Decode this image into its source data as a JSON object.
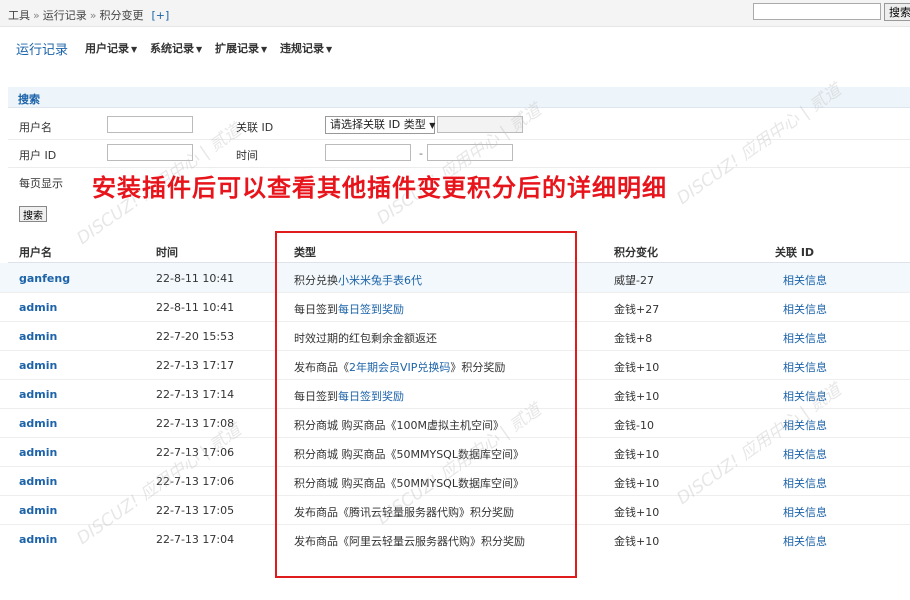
{
  "breadcrumb": {
    "items": [
      "工具",
      "运行记录",
      "积分变更"
    ],
    "separator": "»",
    "add": "[+]"
  },
  "top_search": {
    "value": "",
    "button": "搜索"
  },
  "nav": {
    "active": "运行记录",
    "menus": [
      "用户记录",
      "系统记录",
      "扩展记录",
      "违规记录"
    ],
    "caret": "▼"
  },
  "search_section": {
    "title": "搜索"
  },
  "filters": {
    "username_label": "用户名",
    "relation_label": "关联 ID",
    "relation_select": "请选择关联 ID 类型",
    "userid_label": "用户 ID",
    "time_label": "时间",
    "time_sep": "-",
    "perpage_label": "每页显示",
    "submit": "搜索"
  },
  "overlay_caption": "安装插件后可以查看其他插件变更积分后的详细明细",
  "table": {
    "headers": [
      "用户名",
      "时间",
      "类型",
      "积分变化",
      "关联 ID"
    ],
    "rows": [
      {
        "user": "ganfeng",
        "time": "22-8-11 10:41",
        "type_prefix": "积分兑换",
        "type_link": "小米米兔手表6代",
        "type_suffix": "",
        "change": "威望-27",
        "link": "相关信息"
      },
      {
        "user": "admin",
        "time": "22-8-11 10:41",
        "type_prefix": "每日签到",
        "type_link": "每日签到奖励",
        "type_suffix": "",
        "change": "金钱+27",
        "link": "相关信息"
      },
      {
        "user": "admin",
        "time": "22-7-20 15:53",
        "type_prefix": "时效过期的红包剩余金额返还",
        "type_link": "",
        "type_suffix": "",
        "change": "金钱+8",
        "link": "相关信息"
      },
      {
        "user": "admin",
        "time": "22-7-13 17:17",
        "type_prefix": "发布商品《",
        "type_link": "2年期会员VIP兑换码",
        "type_suffix": "》积分奖励",
        "change": "金钱+10",
        "link": "相关信息"
      },
      {
        "user": "admin",
        "time": "22-7-13 17:14",
        "type_prefix": "每日签到",
        "type_link": "每日签到奖励",
        "type_suffix": "",
        "change": "金钱+10",
        "link": "相关信息"
      },
      {
        "user": "admin",
        "time": "22-7-13 17:08",
        "type_prefix": "积分商城 购买商品《100M虚拟主机空间》",
        "type_link": "",
        "type_suffix": "",
        "change": "金钱-10",
        "link": "相关信息"
      },
      {
        "user": "admin",
        "time": "22-7-13 17:06",
        "type_prefix": "积分商城 购买商品《50MMYSQL数据库空间》",
        "type_link": "",
        "type_suffix": "",
        "change": "金钱+10",
        "link": "相关信息"
      },
      {
        "user": "admin",
        "time": "22-7-13 17:06",
        "type_prefix": "积分商城 购买商品《50MMYSQL数据库空间》",
        "type_link": "",
        "type_suffix": "",
        "change": "金钱+10",
        "link": "相关信息"
      },
      {
        "user": "admin",
        "time": "22-7-13 17:05",
        "type_prefix": "发布商品《腾讯云轻量服务器代购》积分奖励",
        "type_link": "",
        "type_suffix": "",
        "change": "金钱+10",
        "link": "相关信息"
      },
      {
        "user": "admin",
        "time": "22-7-13 17:04",
        "type_prefix": "发布商品《阿里云轻量云服务器代购》积分奖励",
        "type_link": "",
        "type_suffix": "",
        "change": "金钱+10",
        "link": "相关信息"
      }
    ]
  },
  "watermark": "DISCUZ!应用中心 | 贰道 addon.dismall.com"
}
